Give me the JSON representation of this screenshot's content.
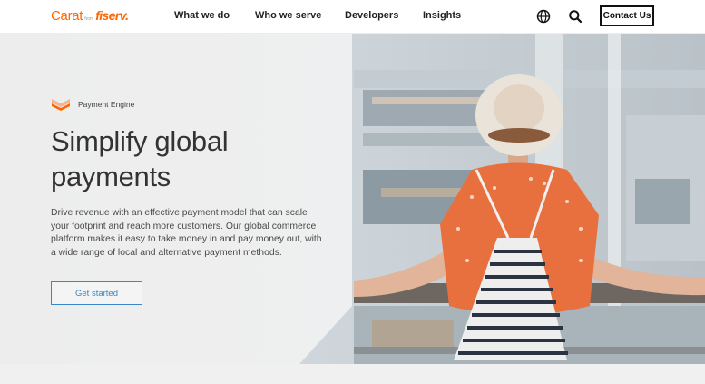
{
  "header": {
    "logo": {
      "carat": "Carat",
      "from": "from",
      "fiserv": "fiserv."
    },
    "nav": [
      "What we do",
      "Who we serve",
      "Developers",
      "Insights"
    ],
    "contact_label": "Contact Us",
    "icons": [
      "globe-icon",
      "search-icon"
    ]
  },
  "hero": {
    "eyebrow": "Payment Engine",
    "headline": "Simplify global payments",
    "description": "Drive revenue with an effective payment model that can scale your footprint and reach more customers. Our global commerce platform makes it easy to take money in and pay money out, with a wide range of local and alternative payment methods.",
    "cta_label": "Get started"
  },
  "colors": {
    "brand": "#ff6600",
    "cta": "#3a86c8",
    "text": "#333333"
  }
}
